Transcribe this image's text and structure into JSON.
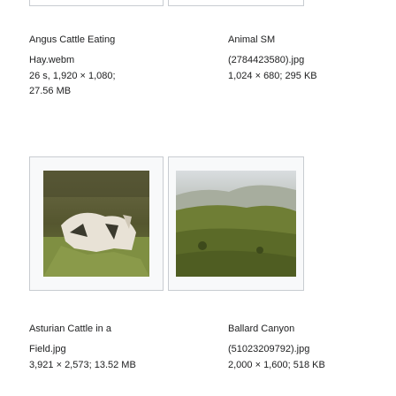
{
  "gallery": {
    "items": [
      {
        "title": "Angus Cattle Eating",
        "file": "Hay.webm",
        "details": "26 s, 1,920 × 1,080;",
        "size": "27.56 MB"
      },
      {
        "title": "Animal SM",
        "file": "(2784423580).jpg",
        "details": "1,024 × 680; 295 KB",
        "size": ""
      },
      {
        "title": "Asturian Cattle in a",
        "file": "Field.jpg",
        "details": "3,921 × 2,573; 13.52 MB",
        "size": ""
      },
      {
        "title": "Ballard Canyon",
        "file": "(51023209792).jpg",
        "details": "2,000 × 1,600; 518 KB",
        "size": ""
      }
    ]
  }
}
